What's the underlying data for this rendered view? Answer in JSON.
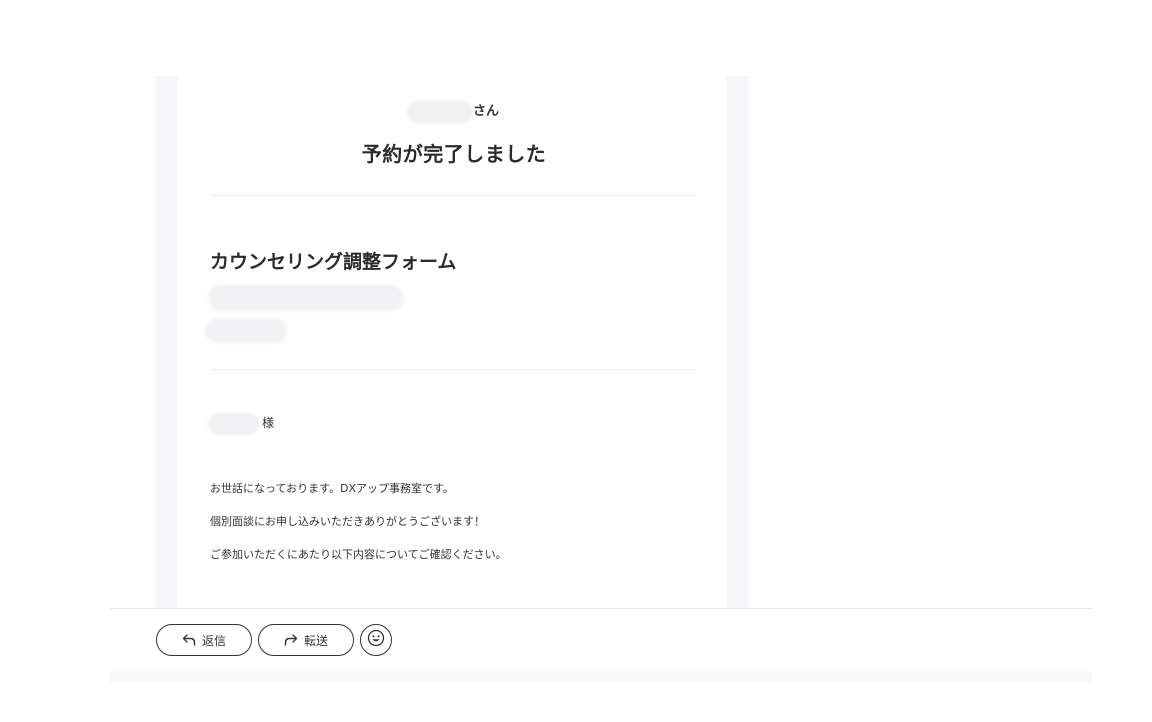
{
  "email": {
    "greeting_suffix": "さん",
    "title": "予約が完了しました",
    "form_name": "カウンセリング調整フォーム",
    "addressee_suffix": "様",
    "body_lines": [
      "お世話になっております。DXアップ事務室です。",
      "個別面談にお申し込みいただきありがとうございます！",
      "ご参加いただくにあたり以下内容についてご確認ください。"
    ]
  },
  "actions": {
    "reply_label": "返信",
    "forward_label": "転送",
    "reply_icon": "reply-arrow-icon",
    "forward_icon": "forward-arrow-icon",
    "emoji_icon": "smiley-icon"
  },
  "colors": {
    "rail": "#f7f7f9",
    "redaction": "#f2f2f4",
    "button_border": "#333333"
  }
}
